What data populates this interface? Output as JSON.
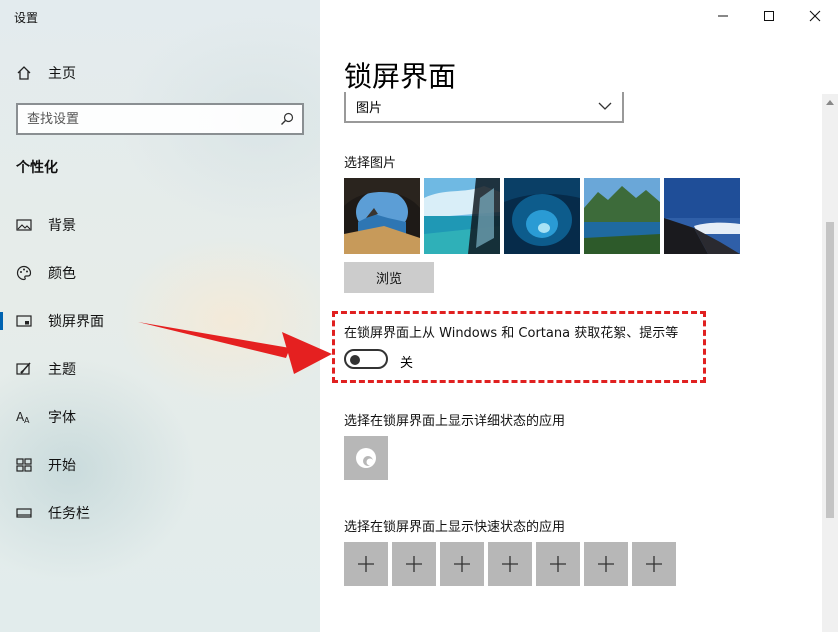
{
  "window": {
    "app_title": "设置"
  },
  "sidebar": {
    "home_label": "主页",
    "search_placeholder": "查找设置",
    "section_title": "个性化",
    "items": [
      {
        "label": "背景",
        "icon": "image-icon"
      },
      {
        "label": "颜色",
        "icon": "palette-icon"
      },
      {
        "label": "锁屏界面",
        "icon": "lock-screen-icon",
        "active": true
      },
      {
        "label": "主题",
        "icon": "theme-icon"
      },
      {
        "label": "字体",
        "icon": "font-icon"
      },
      {
        "label": "开始",
        "icon": "start-icon"
      },
      {
        "label": "任务栏",
        "icon": "taskbar-icon"
      }
    ]
  },
  "main": {
    "page_title": "锁屏界面",
    "background_select": {
      "value": "图片"
    },
    "choose_picture_label": "选择图片",
    "thumbnails": [
      "sea-cave-thumbnail",
      "glass-window-thumbnail",
      "ice-cave-thumbnail",
      "mountain-lake-thumbnail",
      "mountain-clouds-thumbnail"
    ],
    "browse_label": "浏览",
    "fun_facts_label": "在锁屏界面上从 Windows 和 Cortana 获取花絮、提示等",
    "fun_facts_toggle": {
      "state_label": "关",
      "on": false
    },
    "detailed_status_label": "选择在锁屏界面上显示详细状态的应用",
    "detailed_status_app_icon": "weather-icon",
    "quick_status_label": "选择在锁屏界面上显示快速状态的应用",
    "quick_status_slots": [
      "+",
      "+",
      "+",
      "+",
      "+",
      "+",
      "+"
    ]
  },
  "colors": {
    "accent": "#0063b1",
    "highlight": "#e02020",
    "tile_bg": "#b7b7b7"
  }
}
